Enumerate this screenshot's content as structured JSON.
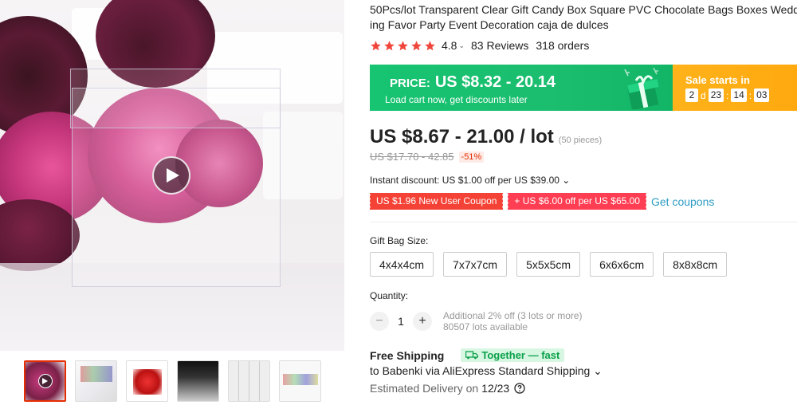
{
  "product": {
    "title_line1": "50Pcs/lot Transparent Clear Gift Candy Box Square PVC Chocolate Bags Boxes Wedd",
    "title_line2": "ing Favor Party Event Decoration caja de dulces",
    "rating": "4.8",
    "rating_chevron": "⌄",
    "reviews": "83 Reviews",
    "orders": "318 orders",
    "stars_count": 5
  },
  "banner": {
    "price_label": "PRICE:",
    "price_value": "US $8.32 - 20.14",
    "sub_text": "Load cart now, get discounts later",
    "sale_label": "Sale starts in",
    "countdown": {
      "days": "2",
      "days_unit": "d",
      "hours": "23",
      "minutes": "14",
      "seconds": "03",
      "sep": ":"
    },
    "color_left": "#17c170",
    "color_right": "#ffad14"
  },
  "pricing": {
    "price": "US $8.67 - 21.00 / lot",
    "pieces": "(50 pieces)",
    "original": "US $17.70 - 42.85",
    "discount": "-51%",
    "instant_discount": "Instant discount: US $1.00 off per US $39.00 ⌄"
  },
  "coupons": {
    "new_user": "US $1.96 New User Coupon",
    "store": "+ US $6.00 off per US $65.00",
    "get_coupons": "Get coupons"
  },
  "variants": {
    "label": "Gift Bag Size:",
    "options": [
      "4x4x4cm",
      "7x7x7cm",
      "5x5x5cm",
      "6x6x6cm",
      "8x8x8cm"
    ]
  },
  "quantity": {
    "label": "Quantity:",
    "minus": "−",
    "plus": "+",
    "value": "1",
    "note1": "Additional 2% off (3 lots or more)",
    "note2": "80507 lots available"
  },
  "shipping": {
    "title": "Free Shipping",
    "badge": "Together — fast",
    "to": "to Babenki via AliExpress Standard Shipping ⌄",
    "estimated_label": "Estimated Delivery on",
    "estimated_date": "12/23"
  },
  "gallery": {
    "thumbnail_count": 6,
    "active_index": 0
  }
}
